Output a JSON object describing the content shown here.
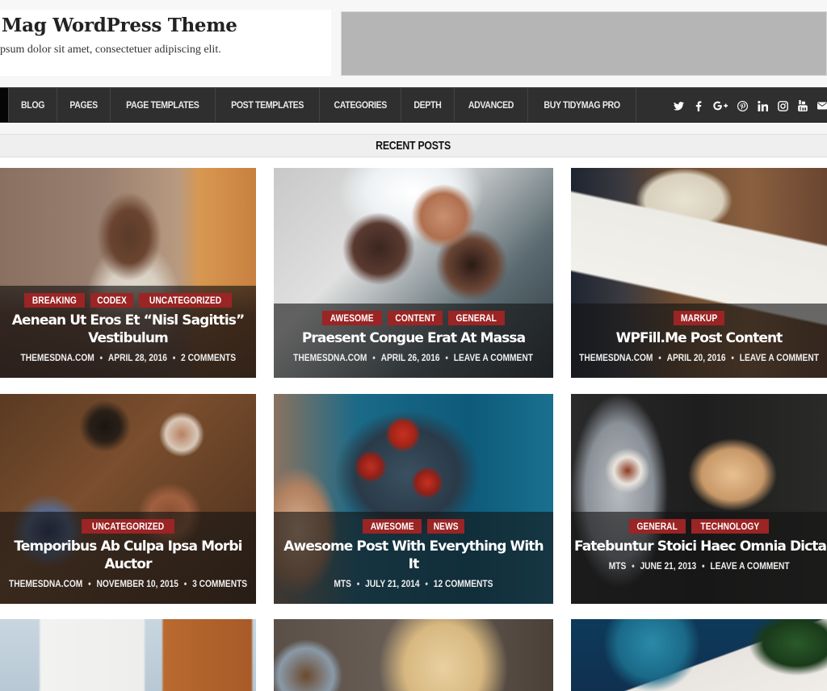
{
  "header": {
    "site_title": "Mag WordPress Theme",
    "site_description": "psum dolor sit amet, consectetuer adipiscing elit."
  },
  "nav": {
    "items": [
      {
        "label": "BLOG"
      },
      {
        "label": "PAGES"
      },
      {
        "label": "PAGE TEMPLATES"
      },
      {
        "label": "POST TEMPLATES"
      },
      {
        "label": "CATEGORIES"
      },
      {
        "label": "DEPTH"
      },
      {
        "label": "ADVANCED"
      },
      {
        "label": "BUY TIDYMAG PRO"
      }
    ],
    "social": [
      {
        "name": "twitter-icon",
        "glyph": "🐦"
      },
      {
        "name": "facebook-icon",
        "glyph": "f"
      },
      {
        "name": "google-plus-icon",
        "glyph": "G+"
      },
      {
        "name": "pinterest-icon",
        "glyph": "℗"
      },
      {
        "name": "linkedin-icon",
        "glyph": "in"
      },
      {
        "name": "instagram-icon",
        "glyph": "◎"
      },
      {
        "name": "youtube-icon",
        "glyph": "▣"
      },
      {
        "name": "email-icon",
        "glyph": "✉"
      }
    ]
  },
  "section": {
    "title": "RECENT POSTS"
  },
  "colors": {
    "accent": "#9b2424",
    "nav_bg": "#2f2f2f"
  },
  "posts": [
    {
      "categories": [
        "BREAKING",
        "CODEX",
        "UNCATEGORIZED"
      ],
      "title": "Aenean Ut Eros Et “Nisl Sagittis” Vestibulum",
      "author": "THEMESDNA.COM",
      "date": "APRIL 28, 2016",
      "comments": "2 COMMENTS"
    },
    {
      "categories": [
        "AWESOME",
        "CONTENT",
        "GENERAL"
      ],
      "title": "Praesent Congue Erat At Massa",
      "author": "THEMESDNA.COM",
      "date": "APRIL 26, 2016",
      "comments": "LEAVE A COMMENT"
    },
    {
      "categories": [
        "MARKUP"
      ],
      "title": "WPFill.Me Post Content",
      "author": "THEMESDNA.COM",
      "date": "APRIL 20, 2016",
      "comments": "LEAVE A COMMENT"
    },
    {
      "categories": [
        "UNCATEGORIZED"
      ],
      "title": "Temporibus Ab Culpa Ipsa Morbi Auctor",
      "author": "THEMESDNA.COM",
      "date": "NOVEMBER 10, 2015",
      "comments": "3 COMMENTS"
    },
    {
      "categories": [
        "AWESOME",
        "NEWS"
      ],
      "title": "Awesome Post With Everything With It",
      "author": "MTS",
      "date": "JULY 21, 2014",
      "comments": "12 COMMENTS"
    },
    {
      "categories": [
        "GENERAL",
        "TECHNOLOGY"
      ],
      "title": "Fatebuntur Stoici Haec Omnia Dicta Esse Praeclare",
      "author": "MTS",
      "date": "JUNE 21, 2013",
      "comments": "LEAVE A COMMENT"
    }
  ]
}
